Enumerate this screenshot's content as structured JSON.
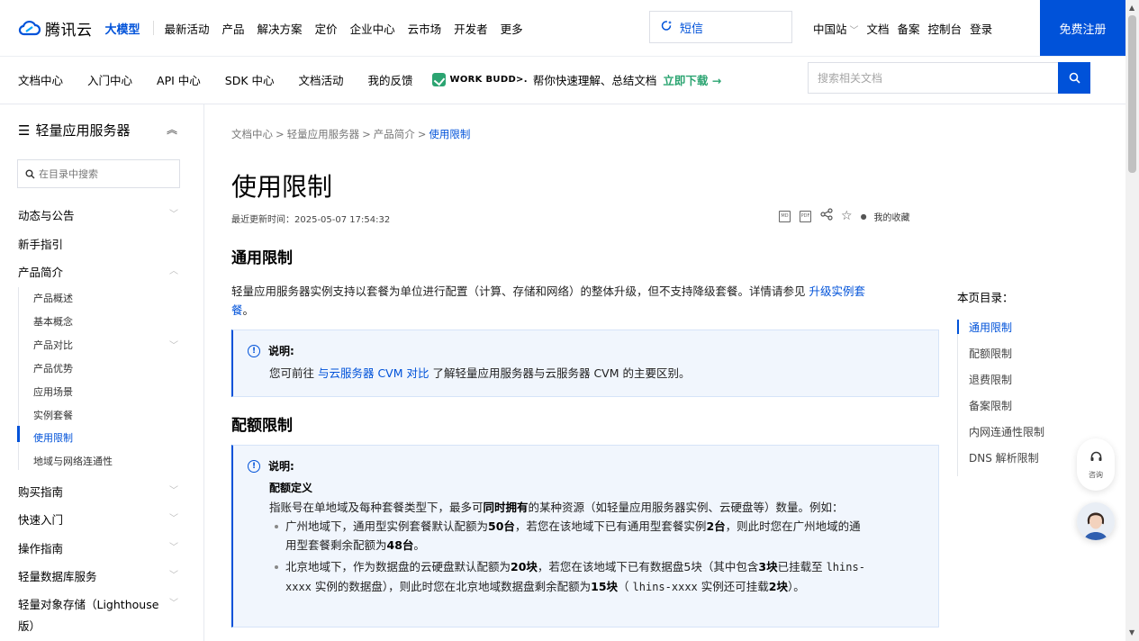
{
  "topnav": {
    "logo_text": "腾讯云",
    "bigmodel": "大模型",
    "items": [
      "最新活动",
      "产品",
      "解决方案",
      "定价",
      "企业中心",
      "云市场",
      "开发者",
      "更多"
    ],
    "search_text": "短信",
    "region": "中国站",
    "links": [
      "文档",
      "备案",
      "控制台",
      "登录"
    ],
    "register": "免费注册"
  },
  "subnav": {
    "items": [
      "文档中心",
      "入门中心",
      "API 中心",
      "SDK 中心",
      "文档活动",
      "我的反馈"
    ],
    "workbuddy_brand": "WORK BUDD>.",
    "workbuddy_desc": "帮你快速理解、总结文档",
    "workbuddy_download": "立即下载 →",
    "search_placeholder": "搜索相关文档"
  },
  "sidebar": {
    "title": "轻量应用服务器",
    "search_placeholder": "在目录中搜索",
    "items": [
      {
        "label": "动态与公告",
        "arrow": "﹀"
      },
      {
        "label": "新手指引",
        "arrow": ""
      },
      {
        "label": "产品简介",
        "arrow": "︿"
      }
    ],
    "subitems": [
      {
        "label": "产品概述",
        "arrow": ""
      },
      {
        "label": "基本概念",
        "arrow": ""
      },
      {
        "label": "产品对比",
        "arrow": "﹀"
      },
      {
        "label": "产品优势",
        "arrow": ""
      },
      {
        "label": "应用场景",
        "arrow": ""
      },
      {
        "label": "实例套餐",
        "arrow": ""
      },
      {
        "label": "使用限制",
        "arrow": ""
      },
      {
        "label": "地域与网络连通性",
        "arrow": ""
      }
    ],
    "items_after": [
      {
        "label": "购买指南",
        "arrow": "﹀"
      },
      {
        "label": "快速入门",
        "arrow": "﹀"
      },
      {
        "label": "操作指南",
        "arrow": "﹀"
      },
      {
        "label": "轻量数据库服务",
        "arrow": "﹀"
      },
      {
        "label": "轻量对象存储（Lighthouse",
        "arrow": "﹀"
      },
      {
        "label": "版）",
        "arrow": ""
      }
    ]
  },
  "breadcrumb": [
    "文档中心",
    "轻量应用服务器",
    "产品简介",
    "使用限制"
  ],
  "breadcrumb_sep": ">",
  "page": {
    "title": "使用限制",
    "updated": "最近更新时间：2025-05-07 17:54:32",
    "favorite": "我的收藏",
    "tool_labels": [
      "MD",
      "PDF"
    ]
  },
  "section1": {
    "heading": "通用限制",
    "text1": "轻量应用服务器实例支持以套餐为单位进行配置（计算、存储和网络）的整体升级，但不支持降级套餐。详情请参见 ",
    "link": "升级实例套",
    "text2": "餐",
    "period": "。",
    "note_label": "说明:",
    "note_pre": "您可前往 ",
    "note_link": "与云服务器 CVM 对比",
    "note_post": " 了解轻量应用服务器与云服务器 CVM 的主要区别。"
  },
  "section2": {
    "heading": "配额限制",
    "note_label": "说明:",
    "def_title": "配额定义",
    "def_a": "指账号在单地域及每种套餐类型下，最多可",
    "def_bold": "同时拥有",
    "def_b": "的某种资源（如轻量应用服务器实例、云硬盘等）数量。例如：",
    "b1_a": "广州地域下，通用型实例套餐默认配额为",
    "b1_50": "50台",
    "b1_b": "，若您在该地域下已有通用型套餐实例",
    "b1_2": "2台",
    "b1_c": "，则此时您在广州地域的通",
    "b1_d": "用型套餐剩余配额为",
    "b1_48": "48台",
    "b1_e": "。",
    "b2_a": "北京地域下，作为数据盘的云硬盘默认配额为",
    "b2_20": "20块",
    "b2_b": "，若您在该地域下已有数据盘5块（其中包含",
    "b2_3": "3块",
    "b2_c": "已挂载至 ",
    "b2_code1": "lhins-",
    "b2_code2": "xxxx",
    "b2_d": " 实例的数据盘），则此时您在北京地域数据盘剩余配额为",
    "b2_15": "15块",
    "b2_e": "（ ",
    "b2_code3": "lhins-xxxx",
    "b2_f": " 实例还可挂载",
    "b2_2": "2块",
    "b2_g": "）。"
  },
  "toc": {
    "title": "本页目录：",
    "items": [
      "通用限制",
      "配额限制",
      "退费限制",
      "备案限制",
      "内网连通性限制",
      "DNS 解析限制"
    ]
  },
  "consult": "咨询",
  "colors": {
    "brand": "#0052d9",
    "green": "#2ba471"
  }
}
